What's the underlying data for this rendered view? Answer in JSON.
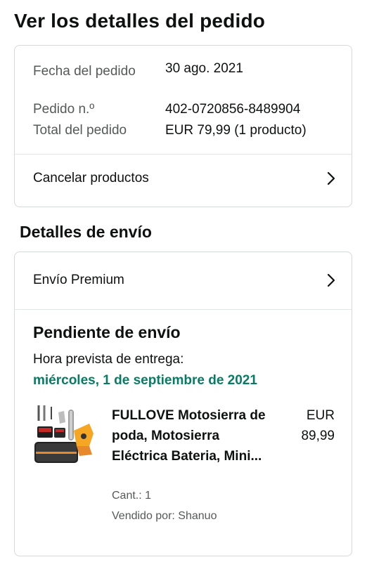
{
  "page": {
    "title": "Ver los detalles del pedido"
  },
  "summary": {
    "order_date_label": "Fecha del pedido",
    "order_date_value": "30 ago. 2021",
    "order_number_label": "Pedido n.º",
    "order_number_value": "402-0720856-8489904",
    "order_total_label": "Total del pedido",
    "order_total_value": "EUR 79,99 (1 producto)",
    "cancel_link": "Cancelar productos"
  },
  "shipping": {
    "section_title": "Detalles de envío",
    "premium_link": "Envío Premium",
    "status_title": "Pendiente de envío",
    "eta_label": "Hora prevista de entrega:",
    "eta_date": "miércoles, 1 de septiembre de 2021"
  },
  "product": {
    "name": "FULLOVE Motosierra de poda, Motosierra Eléctrica Bateria, Mini...",
    "price": "EUR 89,99",
    "quantity": "Cant.: 1",
    "seller": "Vendido por: Shanuo"
  },
  "colors": {
    "eta_green": "#067d62",
    "border": "#d5d9d9",
    "muted_text": "#565959",
    "product_orange": "#f5a623"
  },
  "icons": {
    "chevron": "chevron-right-icon",
    "thumbnail": "chainsaw-kit-thumbnail"
  }
}
